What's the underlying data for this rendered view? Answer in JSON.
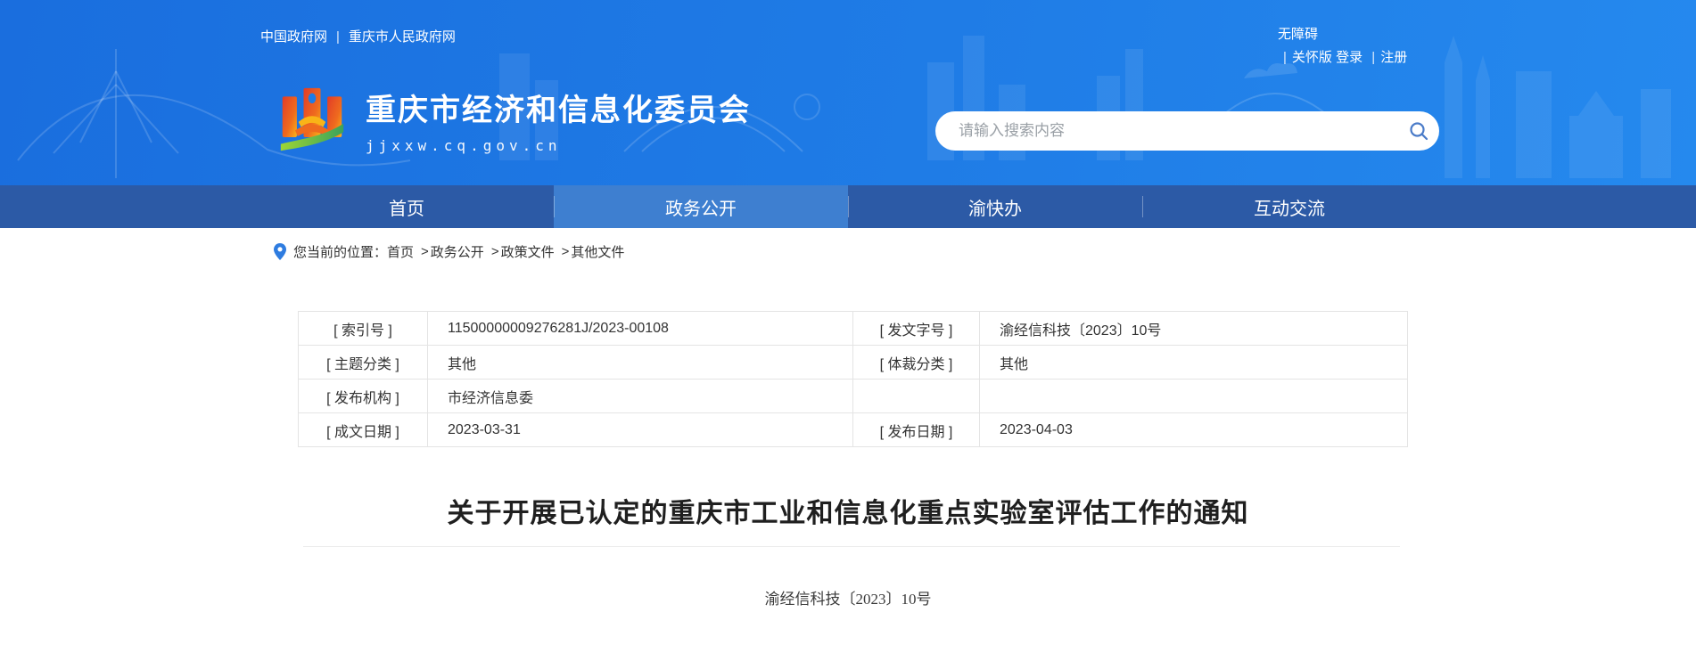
{
  "header": {
    "gov_links": [
      {
        "label": "中国政府网"
      },
      {
        "label": "重庆市人民政府网"
      }
    ],
    "link_divider": "|",
    "accessibility": "无障碍",
    "care_version": "关怀版",
    "login": "登录",
    "register": "注册",
    "site_name": "重庆市经济和信息化委员会",
    "site_domain": "jjxxw.cq.gov.cn",
    "search": {
      "placeholder": "请输入搜索内容",
      "icon": "search-icon"
    }
  },
  "nav": {
    "items": [
      {
        "label": "首页",
        "active": false
      },
      {
        "label": "政务公开",
        "active": true
      },
      {
        "label": "渝快办",
        "active": false
      },
      {
        "label": "互动交流",
        "active": false
      }
    ]
  },
  "breadcrumb": {
    "icon": "location-pin-icon",
    "label": "您当前的位置：",
    "separator": ">",
    "items": [
      {
        "label": "首页"
      },
      {
        "label": "政务公开"
      },
      {
        "label": "政策文件"
      },
      {
        "label": "其他文件"
      }
    ]
  },
  "meta_table": {
    "rows": [
      [
        {
          "label": "[ 索引号 ]",
          "value": "11500000009276281J/2023-00108"
        },
        {
          "label": "[ 发文字号 ]",
          "value": "渝经信科技〔2023〕10号"
        }
      ],
      [
        {
          "label": "[ 主题分类 ]",
          "value": "其他"
        },
        {
          "label": "[ 体裁分类 ]",
          "value": "其他"
        }
      ],
      [
        {
          "label": "[ 发布机构 ]",
          "value": "市经济信息委"
        },
        {
          "label": "",
          "value": ""
        }
      ],
      [
        {
          "label": "[ 成文日期 ]",
          "value": "2023-03-31"
        },
        {
          "label": "[ 发布日期 ]",
          "value": "2023-04-03"
        }
      ]
    ]
  },
  "document": {
    "title": "关于开展已认定的重庆市工业和信息化重点实验室评估工作的通知",
    "doc_number": "渝经信科技〔2023〕10号"
  },
  "colors": {
    "header_gradient_start": "#1a6ede",
    "header_gradient_end": "#2589ee",
    "nav_background": "#2c5aa6",
    "nav_active": "#3e7fd0",
    "accent_blue": "#2e7ce0",
    "table_border": "#e4e4e4",
    "text": "#333333"
  }
}
